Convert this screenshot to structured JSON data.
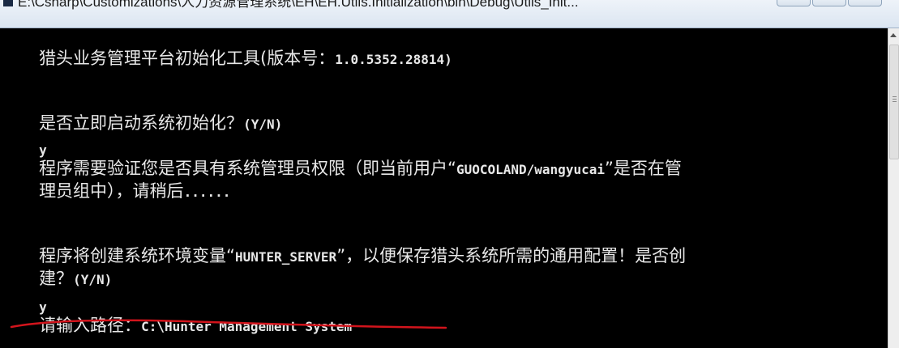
{
  "window": {
    "title": "E:\\Csharp\\Customizations\\人力资源管理系统\\EH\\EH.Utils.Initialization\\bin\\Debug\\Utils_Init..."
  },
  "console": {
    "lines": [
      {
        "zh": "猎头业务管理平台初始化工具(版本号：",
        "en": "1.0.5352.28814)"
      },
      {
        "zh": "是否立即启动系统初始化？",
        "en": "(Y/N)"
      },
      {
        "zh": "",
        "en": "y"
      },
      {
        "zh": "程序需要验证您是否具有系统管理员权限（即当前用户“",
        "en": "GUOCOLAND/wangyucai",
        "zh2": "”是否在管"
      },
      {
        "zh": "理员组中），请稍后",
        "en": "......"
      },
      {
        "zh": "程序将创建系统环境变量“",
        "en": "HUNTER_SERVER",
        "zh2": "”，以便保存猎头系统所需的通用配置！是否创"
      },
      {
        "zh": "建？",
        "en": "(Y/N)"
      },
      {
        "zh": "",
        "en": "y"
      },
      {
        "zh": "请输入路径：",
        "en": "C:\\Hunter Management System"
      }
    ]
  },
  "colors": {
    "console_bg": "#000000",
    "console_text": "#e8e8e8",
    "annotation_underline": "#d2141c"
  }
}
